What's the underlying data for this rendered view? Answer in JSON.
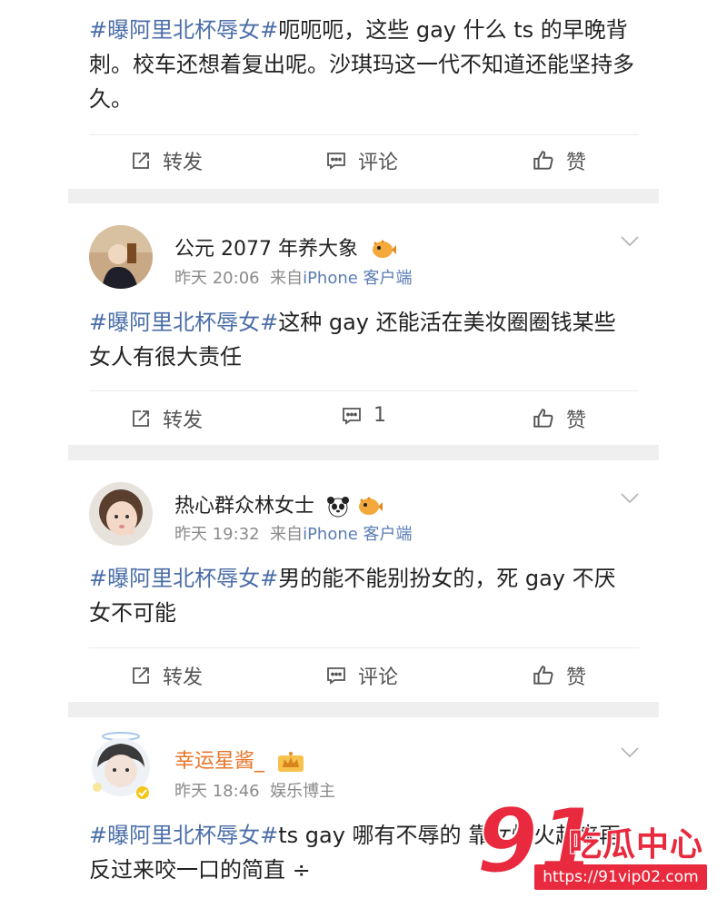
{
  "labels": {
    "repost": "转发",
    "comment": "评论",
    "like": "赞"
  },
  "posts": [
    {
      "hashtag": "#曝阿里北杯辱女#",
      "body": "呃呃呃，这些 gay 什么 ts 的早晚背刺。校车还想着复出呢。沙琪玛这一代不知道还能坚持多久。",
      "comment_count": "评论"
    },
    {
      "user": "公元 2077 年养大象",
      "badge": "pufferfish-icon",
      "time": "昨天 20:06",
      "source_prefix": "来自",
      "source": "iPhone 客户端",
      "hashtag": "#曝阿里北杯辱女#",
      "body": "这种 gay 还能活在美妆圈圈钱某些女人有很大责任",
      "comment_count": "1"
    },
    {
      "user": "热心群众林女士",
      "badge": "panda-pufferfish-icons",
      "time": "昨天 19:32",
      "source_prefix": "来自",
      "source": "iPhone 客户端",
      "hashtag": "#曝阿里北杯辱女#",
      "body": "男的能不能别扮女的，死 gay 不厌女不可能",
      "comment_count": "评论"
    },
    {
      "user": "幸运星酱_",
      "badge": "crown-icon",
      "time": "昨天 18:46",
      "source": "娱乐博主",
      "hashtag": "#曝阿里北杯辱女#",
      "body": "ts gay 哪有不辱的 靠女性火起来再反过来咬一口的简直 ÷"
    }
  ],
  "watermark": {
    "number": "91",
    "text": "吃瓜中心",
    "url": "https://91vip02.com"
  },
  "colors": {
    "hashtag": "#4b6ea8",
    "username_verified": "#e8752a",
    "watermark": "#e8293e"
  }
}
